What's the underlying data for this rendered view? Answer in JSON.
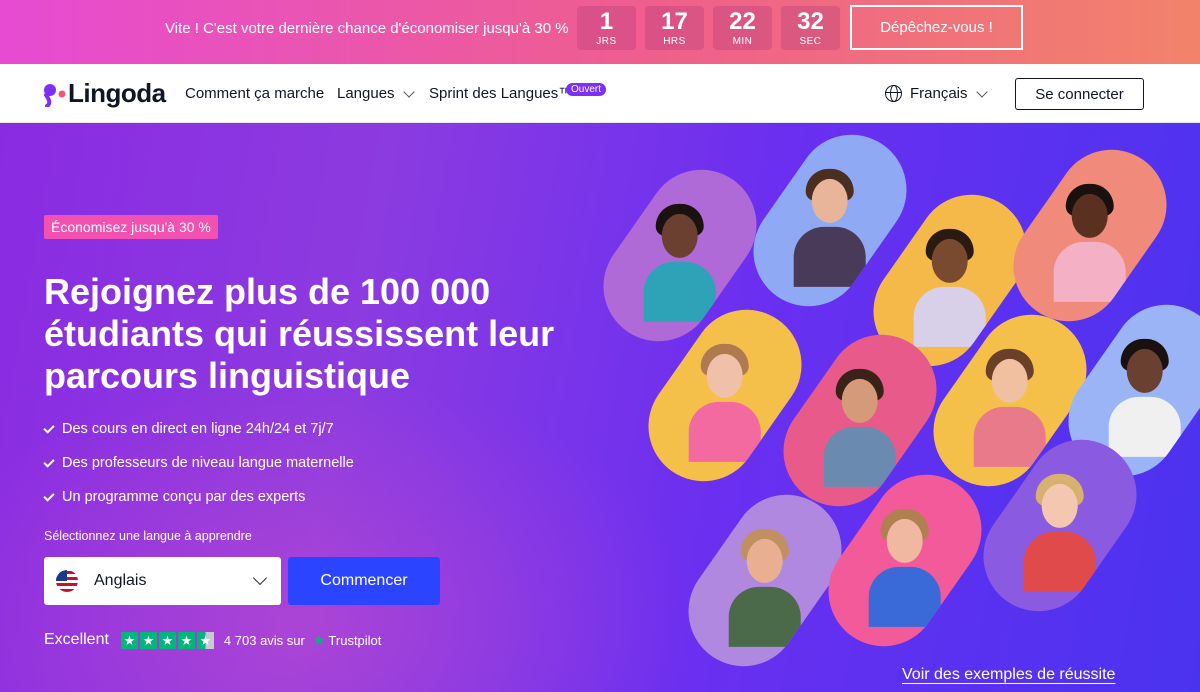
{
  "promo": {
    "text": "Vite ! C'est votre dernière chance d'économiser jusqu'à 30 %",
    "countdown": [
      {
        "value": "1",
        "unit": "JRS"
      },
      {
        "value": "17",
        "unit": "HRS"
      },
      {
        "value": "22",
        "unit": "MIN"
      },
      {
        "value": "32",
        "unit": "SEC"
      }
    ],
    "button_label": "Dépêchez-vous !"
  },
  "nav": {
    "logo_text": "Lingoda",
    "links": {
      "how_it_works": "Comment ça marche",
      "languages": "Langues",
      "sprint": "Sprint des Langues™",
      "sprint_badge": "Ouvert"
    },
    "language": "Français",
    "login_label": "Se connecter"
  },
  "hero": {
    "save_badge": "Économisez jusqu'à 30 %",
    "title": "Rejoignez plus de 100 000 étudiants qui réussissent leur parcours linguistique",
    "features": [
      "Des cours en direct en ligne 24h/24 et 7j/7",
      "Des professeurs de niveau langue maternelle",
      "Un programme conçu par des experts"
    ],
    "select_label": "Sélectionnez une langue à apprendre",
    "selected_language": "Anglais",
    "start_label": "Commencer",
    "rating": {
      "word": "Excellent",
      "stars": 4.5,
      "reviews": "4 703 avis sur",
      "provider": "Trustpilot"
    },
    "success_link": "Voir des exemples de réussite"
  },
  "colors": {
    "accent_blue": "#2b44ff",
    "badge_pink": "#f251b0",
    "trustpilot_green": "#00b67a",
    "hero_purple": "#8a2be2"
  }
}
